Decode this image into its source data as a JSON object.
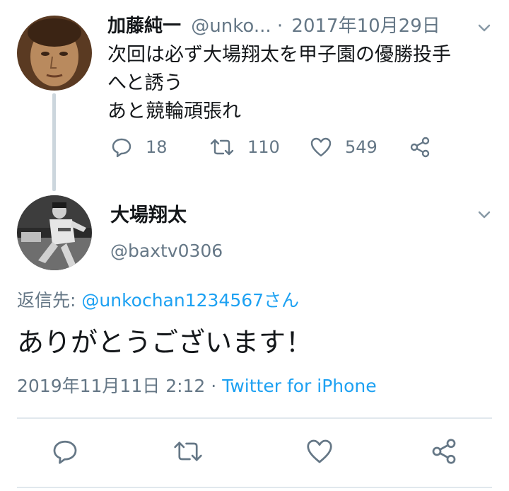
{
  "tweet1": {
    "display_name": "加藤純一",
    "handle": "@unko...",
    "separator": "·",
    "date": "2017年10月29日",
    "text_lines": [
      "次回は必ず大場翔太を甲子園の優勝投手",
      "へと誘う",
      "あと競輪頑張れ"
    ],
    "reply_count": "18",
    "retweet_count": "110",
    "like_count": "549"
  },
  "tweet2": {
    "display_name": "大場翔太",
    "handle": "@baxtv0306",
    "replying_label": "返信先: ",
    "replying_to": "@unkochan1234567",
    "replying_suffix": "さん",
    "text": "ありがとうございます！",
    "timestamp": "2019年11月11日 2:12",
    "separator": "·",
    "source": "Twitter for iPhone"
  },
  "colors": {
    "text": "#14171a",
    "muted": "#657786",
    "link": "#1da1f2",
    "divider": "#e1e8ed",
    "thread_line": "#ccd6dd"
  },
  "icons": [
    "reply-icon",
    "retweet-icon",
    "like-icon",
    "share-icon",
    "chevron-down-icon"
  ]
}
